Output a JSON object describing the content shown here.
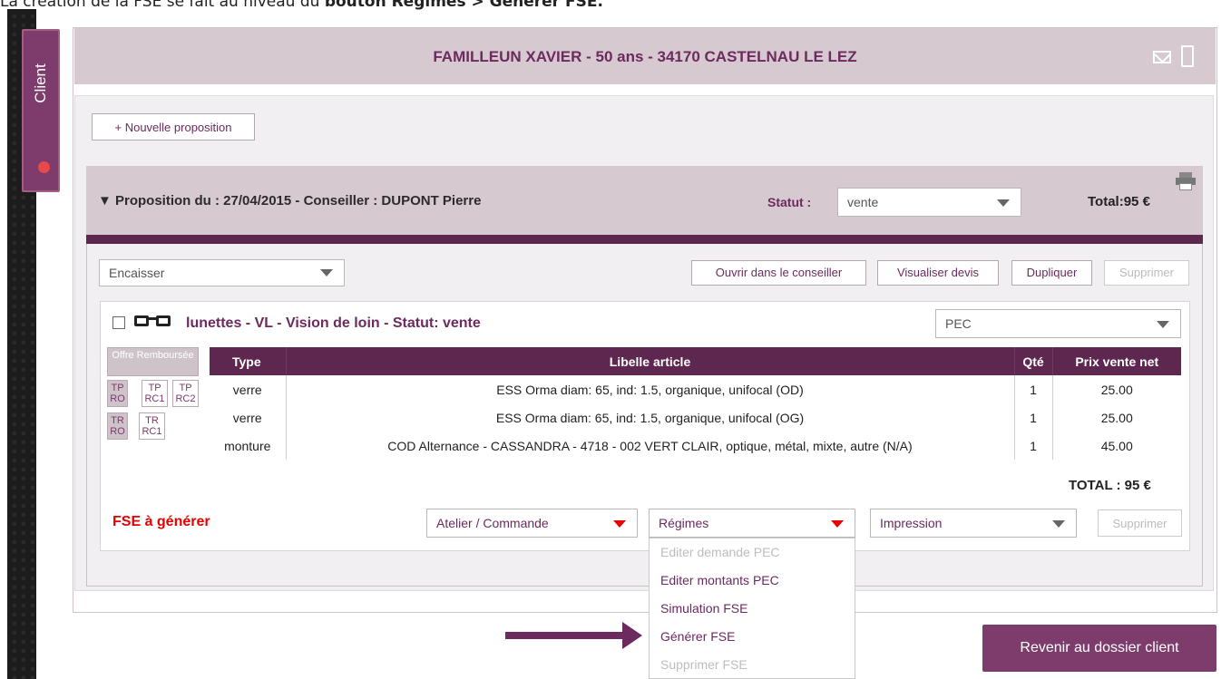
{
  "caption": {
    "prefix": "La création de la FSE se fait au niveau du ",
    "bold": "bouton Régimes > Générer FSE."
  },
  "client_tab": {
    "label": "Client"
  },
  "header": {
    "client_name": "FAMILLEUN XAVIER - 50 ans - 34170 CASTELNAU LE LEZ",
    "icons": [
      "envelope-icon",
      "phone-icon"
    ]
  },
  "new_proposal_label": "+ Nouvelle proposition",
  "proposal": {
    "title": "▼ Proposition du : 27/04/2015 - Conseiller : DUPONT Pierre",
    "statut_label": "Statut :",
    "statut_value": "vente",
    "total": "Total:95 €"
  },
  "actions": {
    "encaisser": "Encaisser",
    "ouvrir": "Ouvrir dans le conseiller",
    "visualiser": "Visualiser devis",
    "dupliquer": "Dupliquer",
    "supprimer": "Supprimer"
  },
  "item": {
    "title": "lunettes - VL - Vision de loin - Statut: vente",
    "pec_select": "PEC",
    "offre": "Offre Remboursée",
    "tp_boxes_row1": [
      {
        "l1": "TP",
        "l2": "RO"
      },
      {
        "l1": "TP",
        "l2": "RC1"
      },
      {
        "l1": "TP",
        "l2": "RC2"
      }
    ],
    "tp_boxes_row2": [
      {
        "l1": "TR",
        "l2": "RO"
      },
      {
        "l1": "TR",
        "l2": "RC1"
      }
    ],
    "columns": [
      "Type",
      "Libelle article",
      "Qté",
      "Prix vente net"
    ],
    "rows": [
      {
        "type": "verre",
        "libelle": "ESS Orma diam: 65, ind: 1.5, organique, unifocal (OD)",
        "qte": "1",
        "prix": "25.00"
      },
      {
        "type": "verre",
        "libelle": "ESS Orma diam: 65, ind: 1.5, organique, unifocal (OG)",
        "qte": "1",
        "prix": "25.00"
      },
      {
        "type": "monture",
        "libelle": "COD Alternance - CASSANDRA - 4718 - 002 VERT CLAIR, optique, métal, mixte, autre (N/A)",
        "qte": "1",
        "prix": "45.00"
      }
    ],
    "total": "TOTAL : 95 €"
  },
  "footer": {
    "fse_label": "FSE à générer",
    "atelier": "Atelier / Commande",
    "regimes": "Régimes",
    "impression": "Impression",
    "supprimer": "Supprimer"
  },
  "regimes_menu": [
    {
      "label": "Editer demande PEC",
      "enabled": false
    },
    {
      "label": "Editer montants PEC",
      "enabled": true
    },
    {
      "label": "Simulation FSE",
      "enabled": true
    },
    {
      "label": "Générer FSE",
      "enabled": true
    },
    {
      "label": "Supprimer FSE",
      "enabled": false
    }
  ],
  "revenir_label": "Revenir au dossier client",
  "colors": {
    "accent_purple": "#5e2750",
    "header_mauve": "#d6c9d0",
    "alert_red": "#e60000"
  }
}
